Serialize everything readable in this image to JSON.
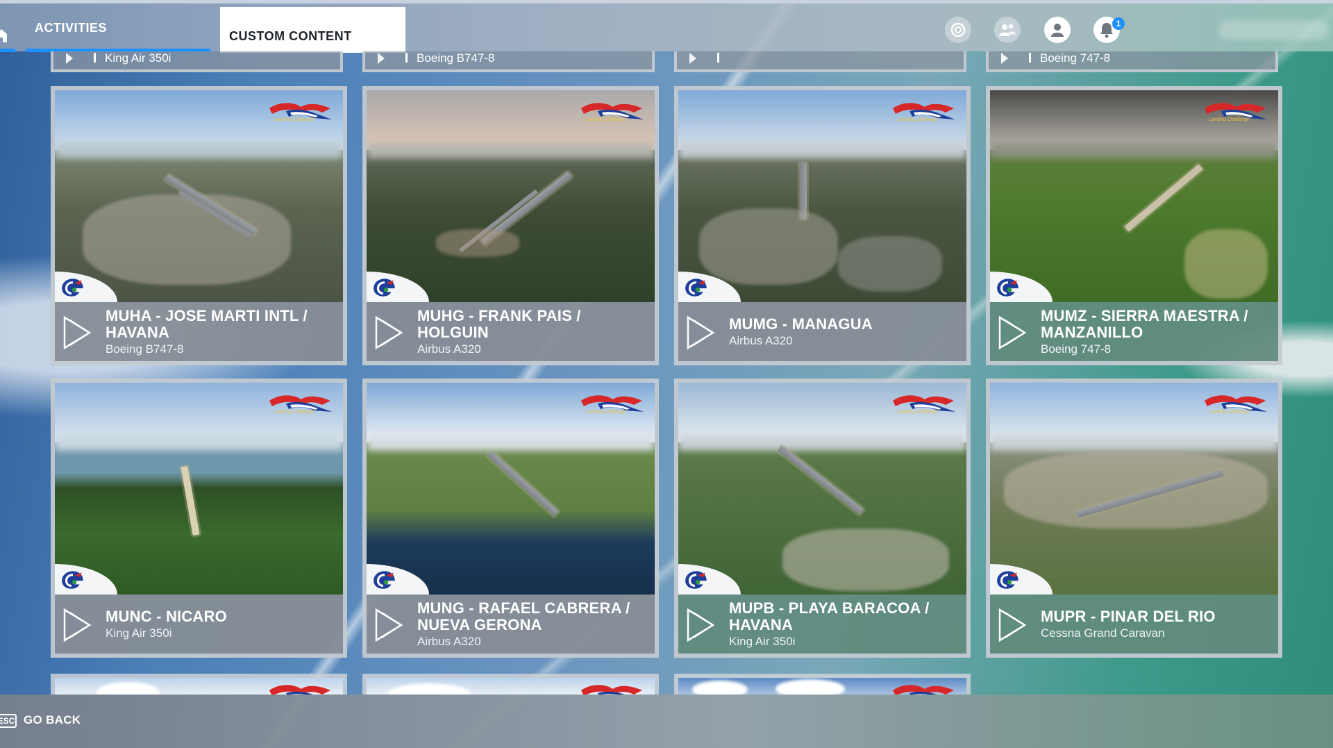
{
  "header": {
    "tabs": [
      {
        "label": "ACTIVITIES",
        "active": true
      },
      {
        "label": "CUSTOM CONTENT",
        "active": false
      }
    ],
    "icons": [
      "home-icon",
      "achievement-icon",
      "friends-icon",
      "profile-icon",
      "notification-bell-icon"
    ],
    "notification_count": "1"
  },
  "partial_top_row": [
    {
      "aircraft": "King Air 350i"
    },
    {
      "aircraft": "Boeing B747-8"
    },
    {
      "aircraft": ""
    },
    {
      "aircraft": "Boeing 747-8"
    }
  ],
  "cards": [
    {
      "title": "MUHA - JOSE MARTI INTL / HAVANA",
      "title_line1": "MUHA - JOSE MARTI INTL /",
      "title_line2": "HAVANA",
      "aircraft": "Boeing B747-8"
    },
    {
      "title": "MUHG - FRANK PAIS / HOLGUIN",
      "title_line1": "MUHG - FRANK PAIS /",
      "title_line2": "HOLGUIN",
      "aircraft": "Airbus A320"
    },
    {
      "title": "MUMG - MANAGUA",
      "title_line1": "MUMG - MANAGUA",
      "title_line2": "",
      "aircraft": "Airbus A320"
    },
    {
      "title": "MUMZ - SIERRA MAESTRA / MANZANILLO",
      "title_line1": "MUMZ - SIERRA MAESTRA /",
      "title_line2": "MANZANILLO",
      "aircraft": "Boeing 747-8"
    },
    {
      "title": "MUNC - NICARO",
      "title_line1": "MUNC - NICARO",
      "title_line2": "",
      "aircraft": "King Air 350i"
    },
    {
      "title": "MUNG - RAFAEL CABRERA / NUEVA GERONA",
      "title_line1": "MUNG - RAFAEL CABRERA /",
      "title_line2": "NUEVA GERONA",
      "aircraft": "Airbus A320"
    },
    {
      "title": "MUPB - PLAYA BARACOA / HAVANA",
      "title_line1": "MUPB - PLAYA BARACOA /",
      "title_line2": "HAVANA",
      "aircraft": "King Air 350i"
    },
    {
      "title": "MUPR - PINAR DEL RIO",
      "title_line1": "MUPR - PINAR DEL RIO",
      "title_line2": "",
      "aircraft": "Cessna Grand Caravan"
    }
  ],
  "footer": {
    "key": "ESC",
    "label": "GO BACK"
  },
  "colors": {
    "accent": "#1e90ff",
    "card_border": "#cdd2d8",
    "info_panel": "#878e96"
  }
}
